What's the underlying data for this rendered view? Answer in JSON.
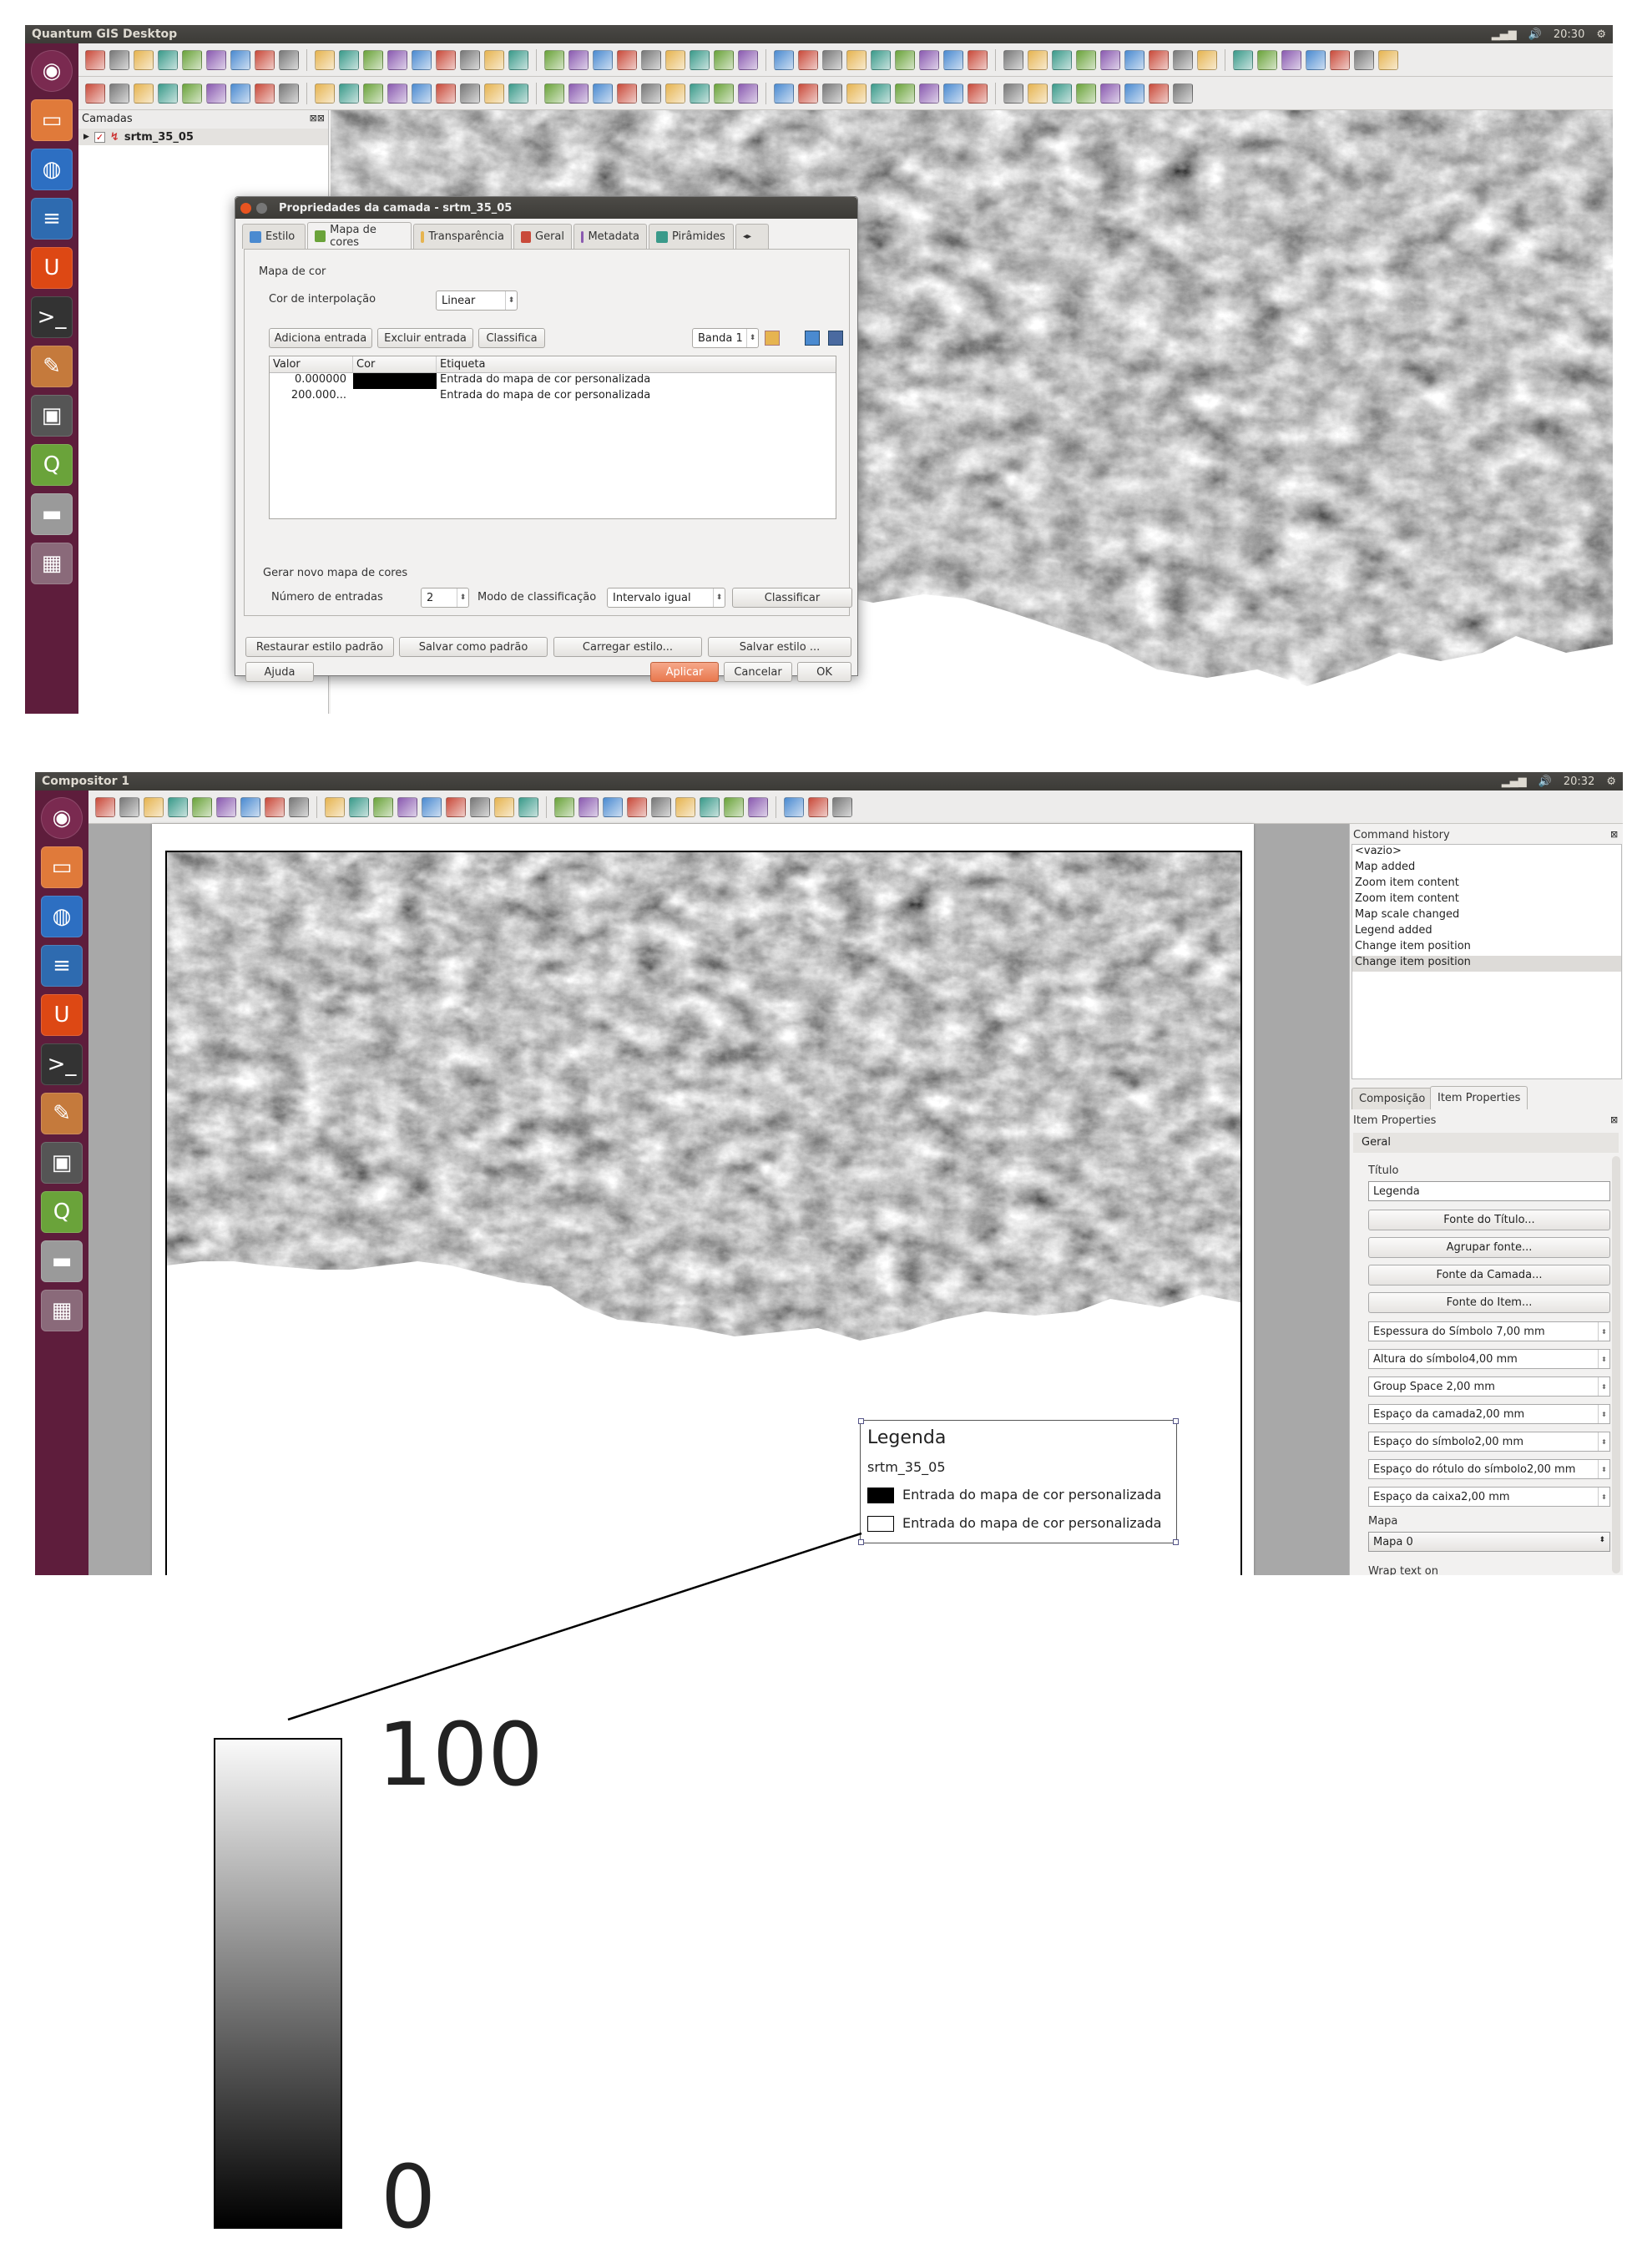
{
  "top": {
    "window_title": "Quantum GIS Desktop",
    "clock": "20:30",
    "layers_panel": {
      "title": "Camadas",
      "layer_name": "srtm_35_05"
    },
    "dialog": {
      "title": "Propriedades da camada - srtm_35_05",
      "tabs": [
        "Estilo",
        "Mapa de cores",
        "Transparência",
        "Geral",
        "Metadata",
        "Pirâmides"
      ],
      "section_label": "Mapa de cor",
      "interp_label": "Cor de interpolação",
      "interp_value": "Linear",
      "add_entry": "Adiciona entrada",
      "delete_entry": "Excluir entrada",
      "classify_small": "Classifica",
      "band": "Banda 1",
      "table_headers": [
        "Valor",
        "Cor",
        "Etiqueta"
      ],
      "rows": [
        {
          "value": "0.000000",
          "color": "#000000",
          "label": "Entrada do mapa de cor personalizada"
        },
        {
          "value": "200.000...",
          "color": "#ffffff",
          "label": "Entrada do mapa de cor personalizada"
        }
      ],
      "gen_label": "Gerar novo mapa de cores",
      "num_entries_label": "Número de entradas",
      "num_entries": "2",
      "mode_label": "Modo de classificação",
      "mode_value": "Intervalo igual",
      "classify": "Classificar",
      "restore": "Restaurar estilo padrão",
      "save_default": "Salvar como padrão",
      "load_style": "Carregar estilo...",
      "save_style": "Salvar estilo ...",
      "help": "Ajuda",
      "apply": "Aplicar",
      "cancel": "Cancelar",
      "ok": "OK"
    }
  },
  "bottom": {
    "window_title": "Compositor 1",
    "clock": "20:32",
    "history_title": "Command history",
    "history": [
      "<vazio>",
      "Map added",
      "Zoom item content",
      "Zoom item content",
      "Map scale changed",
      "Legend added",
      "Change item position",
      "Change item position"
    ],
    "tabs": [
      "Composição",
      "Item Properties"
    ],
    "props_title": "Item Properties",
    "general": "Geral",
    "title_label": "Título",
    "title_value": "Legenda",
    "buttons": [
      "Fonte do Título...",
      "Agrupar fonte...",
      "Fonte da Camada...",
      "Fonte do Item..."
    ],
    "fields": [
      "Espessura do Símbolo 7,00 mm",
      "Altura do símbolo4,00 mm",
      "Group Space 2,00 mm",
      "Espaço da camada2,00 mm",
      "Espaço do símbolo2,00 mm",
      "Espaço do rótulo do símbolo2,00 mm",
      "Espaço da caixa2,00 mm"
    ],
    "map_label": "Mapa",
    "map_value": "Mapa 0",
    "cut_label": "Wrap text on",
    "legend": {
      "title": "Legenda",
      "layer": "srtm_35_05",
      "items": [
        {
          "label": "Entrada do mapa de cor personalizada",
          "color": "#000000"
        },
        {
          "label": "Entrada do mapa de cor personalizada",
          "color": "#ffffff"
        }
      ]
    }
  },
  "colorbar": {
    "max": "100",
    "min": "0"
  }
}
